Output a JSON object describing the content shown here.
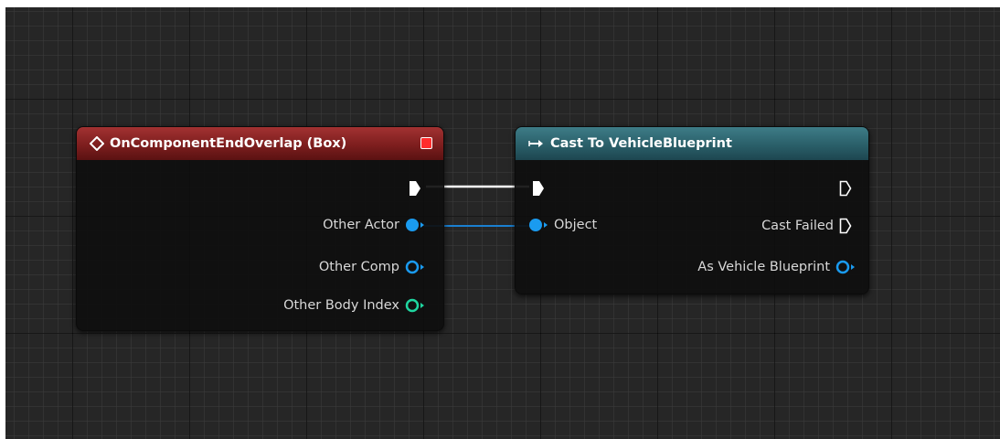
{
  "event_node": {
    "title": "OnComponentEndOverlap (Box)",
    "header_color": "#8b2424",
    "pins": {
      "other_actor": "Other Actor",
      "other_comp": "Other Comp",
      "other_body_index": "Other Body Index"
    }
  },
  "cast_node": {
    "title": "Cast To VehicleBlueprint",
    "header_color": "#2f6b75",
    "pins": {
      "object": "Object",
      "cast_failed": "Cast Failed",
      "as_vehicle_blueprint": "As Vehicle Blueprint"
    }
  },
  "colors": {
    "object_pin": "#1a9bf0",
    "int_pin": "#1fd6a0",
    "exec_pin": "#ffffff"
  },
  "icons": {
    "event": "event-diamond-icon",
    "cast": "cast-arrow-icon",
    "close": "close-icon"
  }
}
